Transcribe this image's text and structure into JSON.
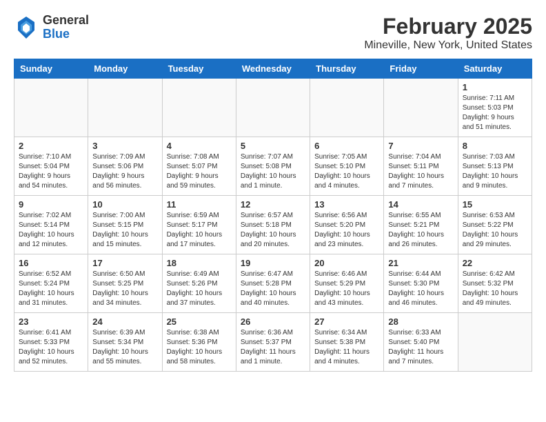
{
  "header": {
    "logo_general": "General",
    "logo_blue": "Blue",
    "title": "February 2025",
    "subtitle": "Mineville, New York, United States"
  },
  "weekdays": [
    "Sunday",
    "Monday",
    "Tuesday",
    "Wednesday",
    "Thursday",
    "Friday",
    "Saturday"
  ],
  "weeks": [
    [
      {
        "day": "",
        "info": ""
      },
      {
        "day": "",
        "info": ""
      },
      {
        "day": "",
        "info": ""
      },
      {
        "day": "",
        "info": ""
      },
      {
        "day": "",
        "info": ""
      },
      {
        "day": "",
        "info": ""
      },
      {
        "day": "1",
        "info": "Sunrise: 7:11 AM\nSunset: 5:03 PM\nDaylight: 9 hours and 51 minutes."
      }
    ],
    [
      {
        "day": "2",
        "info": "Sunrise: 7:10 AM\nSunset: 5:04 PM\nDaylight: 9 hours and 54 minutes."
      },
      {
        "day": "3",
        "info": "Sunrise: 7:09 AM\nSunset: 5:06 PM\nDaylight: 9 hours and 56 minutes."
      },
      {
        "day": "4",
        "info": "Sunrise: 7:08 AM\nSunset: 5:07 PM\nDaylight: 9 hours and 59 minutes."
      },
      {
        "day": "5",
        "info": "Sunrise: 7:07 AM\nSunset: 5:08 PM\nDaylight: 10 hours and 1 minute."
      },
      {
        "day": "6",
        "info": "Sunrise: 7:05 AM\nSunset: 5:10 PM\nDaylight: 10 hours and 4 minutes."
      },
      {
        "day": "7",
        "info": "Sunrise: 7:04 AM\nSunset: 5:11 PM\nDaylight: 10 hours and 7 minutes."
      },
      {
        "day": "8",
        "info": "Sunrise: 7:03 AM\nSunset: 5:13 PM\nDaylight: 10 hours and 9 minutes."
      }
    ],
    [
      {
        "day": "9",
        "info": "Sunrise: 7:02 AM\nSunset: 5:14 PM\nDaylight: 10 hours and 12 minutes."
      },
      {
        "day": "10",
        "info": "Sunrise: 7:00 AM\nSunset: 5:15 PM\nDaylight: 10 hours and 15 minutes."
      },
      {
        "day": "11",
        "info": "Sunrise: 6:59 AM\nSunset: 5:17 PM\nDaylight: 10 hours and 17 minutes."
      },
      {
        "day": "12",
        "info": "Sunrise: 6:57 AM\nSunset: 5:18 PM\nDaylight: 10 hours and 20 minutes."
      },
      {
        "day": "13",
        "info": "Sunrise: 6:56 AM\nSunset: 5:20 PM\nDaylight: 10 hours and 23 minutes."
      },
      {
        "day": "14",
        "info": "Sunrise: 6:55 AM\nSunset: 5:21 PM\nDaylight: 10 hours and 26 minutes."
      },
      {
        "day": "15",
        "info": "Sunrise: 6:53 AM\nSunset: 5:22 PM\nDaylight: 10 hours and 29 minutes."
      }
    ],
    [
      {
        "day": "16",
        "info": "Sunrise: 6:52 AM\nSunset: 5:24 PM\nDaylight: 10 hours and 31 minutes."
      },
      {
        "day": "17",
        "info": "Sunrise: 6:50 AM\nSunset: 5:25 PM\nDaylight: 10 hours and 34 minutes."
      },
      {
        "day": "18",
        "info": "Sunrise: 6:49 AM\nSunset: 5:26 PM\nDaylight: 10 hours and 37 minutes."
      },
      {
        "day": "19",
        "info": "Sunrise: 6:47 AM\nSunset: 5:28 PM\nDaylight: 10 hours and 40 minutes."
      },
      {
        "day": "20",
        "info": "Sunrise: 6:46 AM\nSunset: 5:29 PM\nDaylight: 10 hours and 43 minutes."
      },
      {
        "day": "21",
        "info": "Sunrise: 6:44 AM\nSunset: 5:30 PM\nDaylight: 10 hours and 46 minutes."
      },
      {
        "day": "22",
        "info": "Sunrise: 6:42 AM\nSunset: 5:32 PM\nDaylight: 10 hours and 49 minutes."
      }
    ],
    [
      {
        "day": "23",
        "info": "Sunrise: 6:41 AM\nSunset: 5:33 PM\nDaylight: 10 hours and 52 minutes."
      },
      {
        "day": "24",
        "info": "Sunrise: 6:39 AM\nSunset: 5:34 PM\nDaylight: 10 hours and 55 minutes."
      },
      {
        "day": "25",
        "info": "Sunrise: 6:38 AM\nSunset: 5:36 PM\nDaylight: 10 hours and 58 minutes."
      },
      {
        "day": "26",
        "info": "Sunrise: 6:36 AM\nSunset: 5:37 PM\nDaylight: 11 hours and 1 minute."
      },
      {
        "day": "27",
        "info": "Sunrise: 6:34 AM\nSunset: 5:38 PM\nDaylight: 11 hours and 4 minutes."
      },
      {
        "day": "28",
        "info": "Sunrise: 6:33 AM\nSunset: 5:40 PM\nDaylight: 11 hours and 7 minutes."
      },
      {
        "day": "",
        "info": ""
      }
    ]
  ]
}
